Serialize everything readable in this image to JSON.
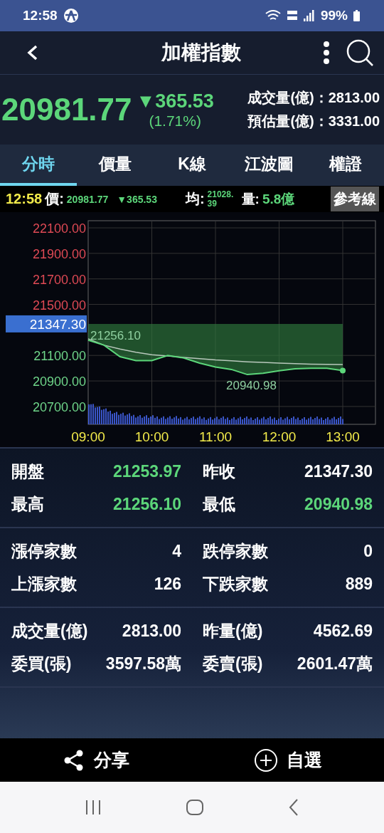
{
  "status_bar": {
    "time": "12:58",
    "battery": "99%"
  },
  "header": {
    "title": "加權指數"
  },
  "quote": {
    "price": "20981.77",
    "change": "▼365.53",
    "percent": "(1.71%)",
    "stats": [
      {
        "label": "成交量(億)：",
        "value": "2813.00"
      },
      {
        "label": "預估量(億)：",
        "value": "3331.00"
      }
    ]
  },
  "tabs": [
    {
      "label": "分時",
      "selected": true
    },
    {
      "label": "價量",
      "selected": false
    },
    {
      "label": "K線",
      "selected": false
    },
    {
      "label": "江波圖",
      "selected": false
    },
    {
      "label": "權證",
      "selected": false
    }
  ],
  "info": {
    "time": "12:58",
    "price_label": "價:",
    "price": "20981.77",
    "change": "▼365.53",
    "avg_label": "均:",
    "avg": "21028.39",
    "volume_label": "量:",
    "volume": "5.8億",
    "button": "參考線"
  },
  "chart": {
    "reference_tag": "21347.30",
    "high_label": "21256.10",
    "low_label": "20940.98",
    "chart_data": {
      "type": "line",
      "grid": true,
      "categories": [
        "09:00",
        null,
        null,
        null,
        "10:00",
        null,
        null,
        null,
        "11:00",
        null,
        null,
        null,
        "12:00",
        null,
        null,
        null,
        "13:00"
      ],
      "series": [
        {
          "color": "#5cd67a",
          "values": [
            21220,
            21180,
            21090,
            21060,
            21060,
            21100,
            21080,
            21040,
            21010,
            20990,
            20950,
            20960,
            20980,
            20995,
            21000,
            21000,
            20982
          ]
        },
        {
          "color": "#b8c8bc",
          "values": [
            21230,
            21180,
            21150,
            21125,
            21105,
            21095,
            21085,
            21075,
            21065,
            21058,
            21050,
            21045,
            21040,
            21036,
            21032,
            21030,
            21028
          ]
        }
      ],
      "ylim": [
        20560,
        22156
      ],
      "yticks": [
        {
          "value": 22100,
          "label": "22100.00"
        },
        {
          "value": 21900,
          "label": "21900.00"
        },
        {
          "value": 21700,
          "label": "21700.00"
        },
        {
          "value": 21500,
          "label": "21500.00"
        },
        {
          "value": 21100,
          "label": "21100.00"
        },
        {
          "value": 20900,
          "label": "20900.00"
        },
        {
          "value": 20700,
          "label": "20700.00"
        }
      ]
    }
  },
  "sections": [
    [
      {
        "label": "開盤",
        "value": "21253.97",
        "color": "#5cd67a"
      },
      {
        "label": "昨收",
        "value": "21347.30",
        "color": "#ffffff"
      },
      {
        "label": "最高",
        "value": "21256.10",
        "color": "#5cd67a"
      },
      {
        "label": "最低",
        "value": "20940.98",
        "color": "#5cd67a"
      }
    ],
    [
      {
        "label": "漲停家數",
        "value": "4",
        "color": "#ffffff"
      },
      {
        "label": "跌停家數",
        "value": "0",
        "color": "#ffffff"
      },
      {
        "label": "上漲家數",
        "value": "126",
        "color": "#ffffff"
      },
      {
        "label": "下跌家數",
        "value": "889",
        "color": "#ffffff"
      }
    ],
    [
      {
        "label": "成交量(億)",
        "value": "2813.00",
        "color": "#ffffff"
      },
      {
        "label": "昨量(億)",
        "value": "4562.69",
        "color": "#ffffff"
      },
      {
        "label": "委買(張)",
        "value": "3597.58萬",
        "color": "#ffffff"
      },
      {
        "label": "委賣(張)",
        "value": "2601.47萬",
        "color": "#ffffff"
      }
    ]
  ],
  "bottom_bar": [
    {
      "kind": "share",
      "label": "分享"
    },
    {
      "kind": "add",
      "label": "自選"
    }
  ]
}
